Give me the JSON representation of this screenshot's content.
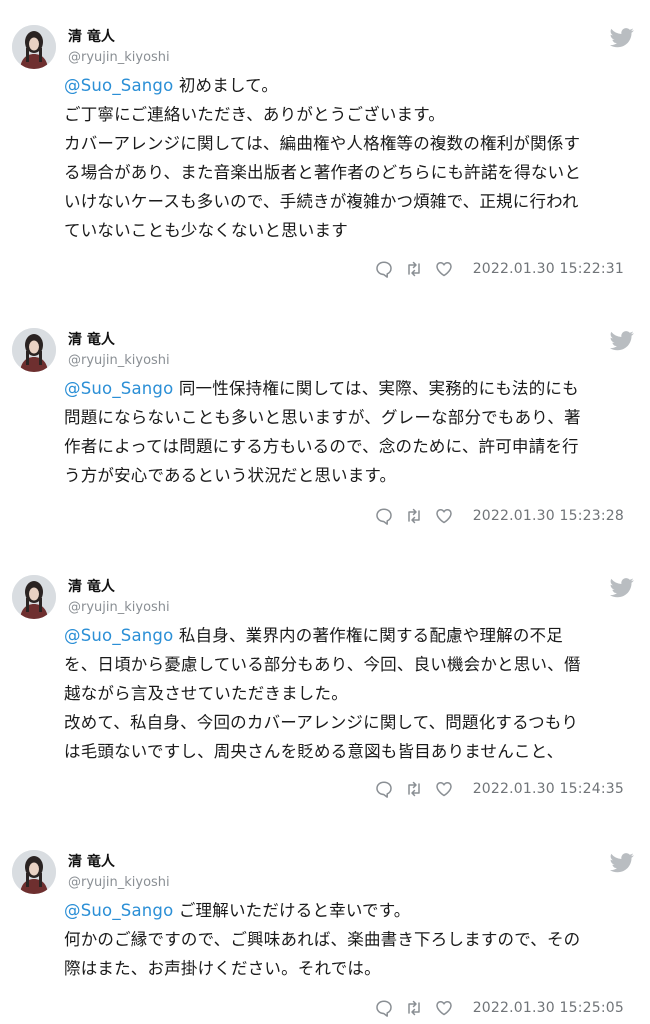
{
  "tweets": [
    {
      "author": "清 竜人",
      "handle": "@ryujin_kiyoshi",
      "mention": "@Suo_Sango",
      "lines": [
        "初めまして。",
        "ご丁寧にご連絡いただき、ありがとうございます。",
        "カバーアレンジに関しては、編曲権や人格権等の複数の権利が関係す",
        "る場合があり、また音楽出版者と著作者のどちらにも許諾を得ないと",
        "いけないケースも多いので、手続きが複雑かつ煩雑で、正規に行われ",
        "ていないことも少なくないと思います"
      ],
      "timestamp": "2022.01.30 15:22:31"
    },
    {
      "author": "清 竜人",
      "handle": "@ryujin_kiyoshi",
      "mention": "@Suo_Sango",
      "lines": [
        "同一性保持権に関しては、実際、実務的にも法的にも",
        "問題にならないことも多いと思いますが、グレーな部分でもあり、著",
        "作者によっては問題にする方もいるので、念のために、許可申請を行",
        "う方が安心であるという状況だと思います。"
      ],
      "timestamp": "2022.01.30 15:23:28"
    },
    {
      "author": "清 竜人",
      "handle": "@ryujin_kiyoshi",
      "mention": "@Suo_Sango",
      "lines": [
        "私自身、業界内の著作権に関する配慮や理解の不足",
        "を、日頃から憂慮している部分もあり、今回、良い機会かと思い、僭",
        "越ながら言及させていただきました。",
        "改めて、私自身、今回のカバーアレンジに関して、問題化するつもり",
        "は毛頭ないですし、周央さんを貶める意図も皆目ありませんこと、"
      ],
      "timestamp": "2022.01.30 15:24:35"
    },
    {
      "author": "清 竜人",
      "handle": "@ryujin_kiyoshi",
      "mention": "@Suo_Sango",
      "lines": [
        "ご理解いただけると幸いです。",
        "何かのご縁ですので、ご興味あれば、楽曲書き下ろしますので、その",
        "際はまた、お声掛けください。それでは。"
      ],
      "timestamp": "2022.01.30 15:25:05"
    }
  ],
  "icons": {
    "platform": "twitter-bird-icon",
    "reply": "reply-icon",
    "retweet": "retweet-icon",
    "like": "heart-icon"
  },
  "colors": {
    "mention": "#2b8fd6",
    "meta": "#8a8f94",
    "bird": "#b9bdc1"
  }
}
